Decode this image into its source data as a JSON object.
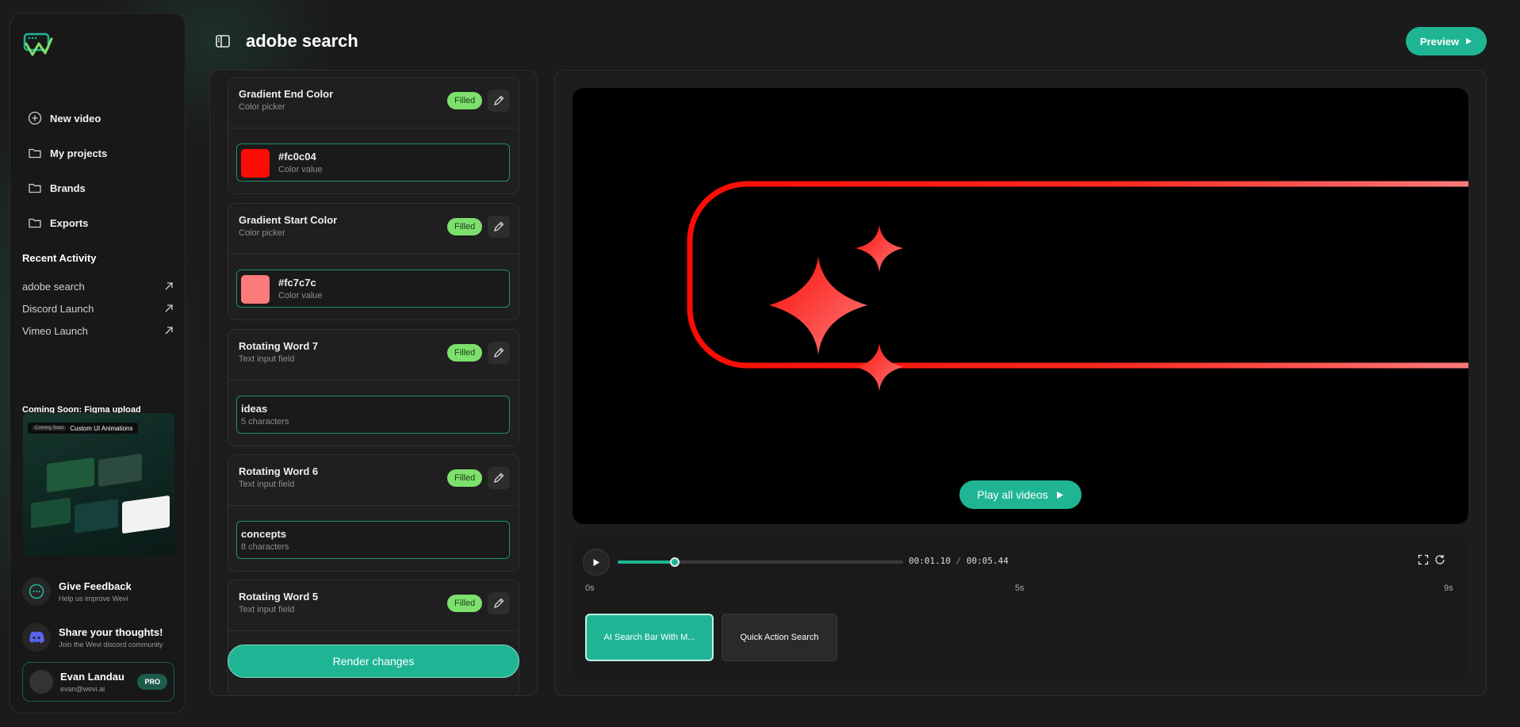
{
  "colors": {
    "accent": "#1fb594",
    "filled_badge": "#7ee06c",
    "pro_badge": "#1d5c4c"
  },
  "sidebar": {
    "nav": [
      {
        "label": "New video",
        "icon": "plus-circle-icon"
      },
      {
        "label": "My projects",
        "icon": "folder-icon"
      },
      {
        "label": "Brands",
        "icon": "folder-icon"
      },
      {
        "label": "Exports",
        "icon": "folder-icon"
      }
    ],
    "recent_title": "Recent Activity",
    "recent": [
      {
        "label": "adobe search"
      },
      {
        "label": "Discord Launch"
      },
      {
        "label": "Vimeo Launch"
      }
    ],
    "coming_soon": "Coming Soon: Figma upload",
    "promo": {
      "chip": "Coming Soon",
      "title": "Custom UI Animations"
    },
    "feedback": {
      "title": "Give Feedback",
      "sub": "Help us improve Wevi"
    },
    "discord": {
      "title": "Share your thoughts!",
      "sub": "Join the Wevi discord community"
    },
    "user": {
      "name": "Evan Landau",
      "email": "evan@wevi.ai",
      "badge": "PRO"
    }
  },
  "header": {
    "title": "adobe search",
    "preview_label": "Preview"
  },
  "fields": [
    {
      "title": "Gradient End Color",
      "sub": "Color picker",
      "status": "Filled",
      "value": "#fc0c04",
      "value_sub": "Color value",
      "swatch": "#fc0c04"
    },
    {
      "title": "Gradient Start Color",
      "sub": "Color picker",
      "status": "Filled",
      "value": "#fc7c7c",
      "value_sub": "Color value",
      "swatch": "#fc7c7c"
    },
    {
      "title": "Rotating Word 7",
      "sub": "Text input field",
      "status": "Filled",
      "value": "ideas",
      "value_sub": "5 characters"
    },
    {
      "title": "Rotating Word 6",
      "sub": "Text input field",
      "status": "Filled",
      "value": "concepts",
      "value_sub": "8 characters"
    },
    {
      "title": "Rotating Word 5",
      "sub": "Text input field",
      "status": "Filled"
    }
  ],
  "render_label": "Render changes",
  "player": {
    "play_all": "Play all videos",
    "current_time": "00:01.10",
    "separator": "/",
    "total_time": "00:05.44",
    "progress": 0.2,
    "ticks": [
      "0s",
      "5s",
      "9s"
    ],
    "clips": [
      {
        "label": "AI Search Bar With M..."
      },
      {
        "label": "Quick Action Search"
      }
    ]
  }
}
